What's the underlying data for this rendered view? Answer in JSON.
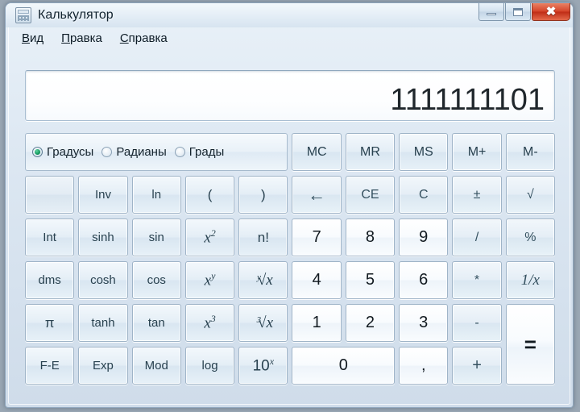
{
  "window": {
    "title": "Калькулятор",
    "icon": "calculator-icon",
    "controls": {
      "minimize": "−",
      "maximize": "□",
      "close": "✕"
    }
  },
  "menubar": {
    "items": [
      {
        "accel": "В",
        "rest": "ид"
      },
      {
        "accel": "П",
        "rest": "равка"
      },
      {
        "accel": "С",
        "rest": "правка"
      }
    ]
  },
  "display": {
    "value": "1111111101"
  },
  "angle_modes": [
    {
      "label": "Градусы",
      "selected": true
    },
    {
      "label": "Радианы",
      "selected": false
    },
    {
      "label": "Грады",
      "selected": false
    }
  ],
  "memory_buttons": [
    "MC",
    "MR",
    "MS",
    "M+",
    "M-"
  ],
  "keys": {
    "row2": [
      "",
      "Inv",
      "ln",
      "(",
      ")",
      "←",
      "CE",
      "C",
      "±",
      "√"
    ],
    "row3": [
      "Int",
      "sinh",
      "sin",
      "x²",
      "n!",
      "7",
      "8",
      "9",
      "/",
      "%"
    ],
    "row4": [
      "dms",
      "cosh",
      "cos",
      "xʸ",
      "ʸ√x",
      "4",
      "5",
      "6",
      "*",
      "1/x"
    ],
    "row5": [
      "π",
      "tanh",
      "tan",
      "x³",
      "³√x",
      "1",
      "2",
      "3",
      "-",
      "="
    ],
    "row6": [
      "F-E",
      "Exp",
      "Mod",
      "log",
      "10ˣ",
      "0",
      ",",
      "+"
    ]
  }
}
